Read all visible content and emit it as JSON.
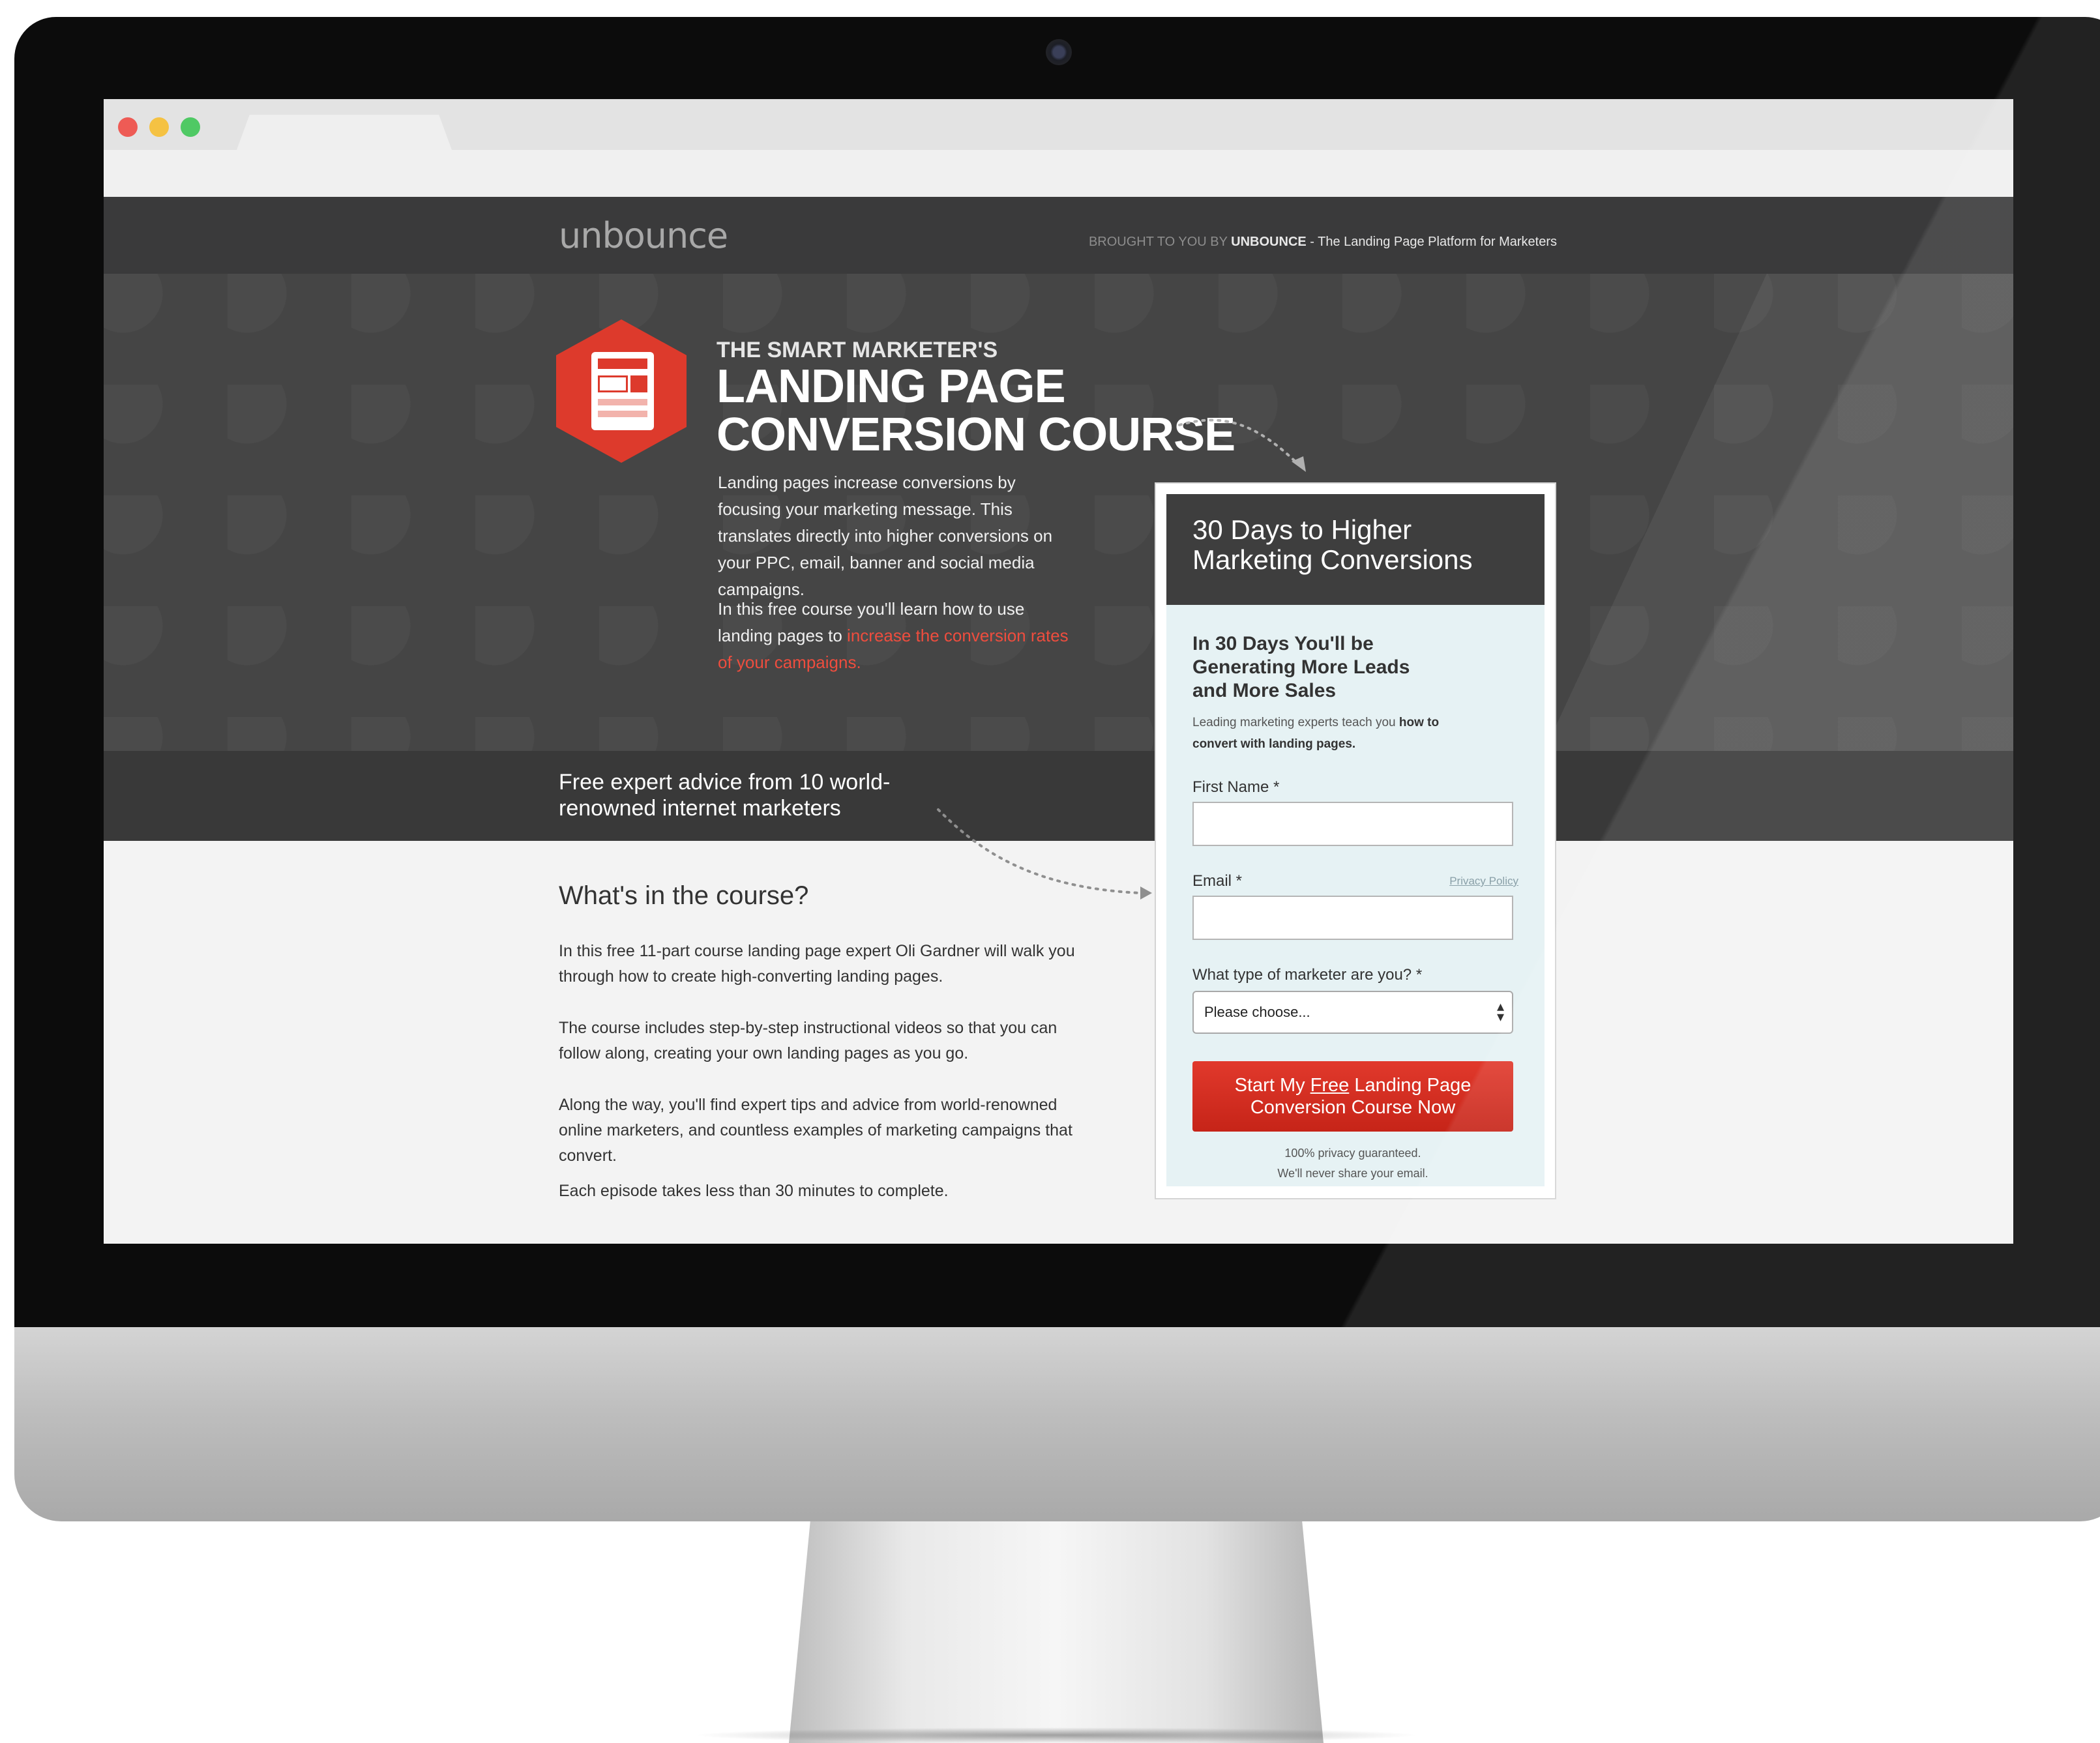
{
  "brand": {
    "logo": "unbounce",
    "brought_prefix": "BROUGHT TO YOU BY ",
    "brought_name": "UNBOUNCE",
    "brought_tagline": " - The Landing Page Platform for Marketers"
  },
  "hero": {
    "kicker": "THE SMART MARKETER'S",
    "headline_line1": "LANDING PAGE",
    "headline_line2": "CONVERSION COURSE",
    "p1": "Landing pages increase conversions by focusing your marketing message. This translates directly into higher conversions on your PPC, email, banner and social media campaigns.",
    "p2_start": "In this free course you'll learn how to use landing pages to ",
    "p2_highlight": "increase the conversion rates of your campaigns."
  },
  "band": {
    "text": "Free expert advice from 10 world-renowned internet marketers"
  },
  "content": {
    "heading": "What's in the course?",
    "p1": "In this free 11-part course landing page expert Oli Gardner will walk you through how to create high-converting landing pages.",
    "p2": "The course includes step-by-step instructional videos so that you can follow along, creating your own landing pages as you go.",
    "p3": "Along the way, you'll find expert tips and advice from world-renowned online marketers, and countless examples of marketing campaigns that convert.",
    "p4": "Each episode takes less than 30 minutes to complete."
  },
  "form": {
    "header_line1": "30 Days to Higher",
    "header_line2": "Marketing Conversions",
    "sub_line1": "In 30 Days You'll be",
    "sub_line2": "Generating More Leads",
    "sub_line3": "and More Sales",
    "desc_start": "Leading marketing experts teach you ",
    "desc_bold1": "how to",
    "desc_bold2": "convert with landing pages.",
    "first_name_label": "First Name *",
    "first_name_value": "",
    "email_label": "Email *",
    "email_value": "",
    "privacy_link": "Privacy Policy",
    "marketer_label": "What type of marketer are you? *",
    "marketer_selected": "Please choose...",
    "cta_start": "Start My ",
    "cta_free": "Free",
    "cta_end": " Landing Page",
    "cta_line2": "Conversion Course Now",
    "guarantee_line1": "100% privacy guaranteed.",
    "guarantee_line2": "We'll never share your email."
  },
  "icons": {
    "hero_icon": "landing-page-document-icon",
    "select_icon": "select-arrows-icon"
  },
  "colors": {
    "accent_red": "#dd3a2c",
    "cta_red": "#c62418",
    "header_dark": "#3a3a3b",
    "form_bg": "#e6f2f4"
  }
}
